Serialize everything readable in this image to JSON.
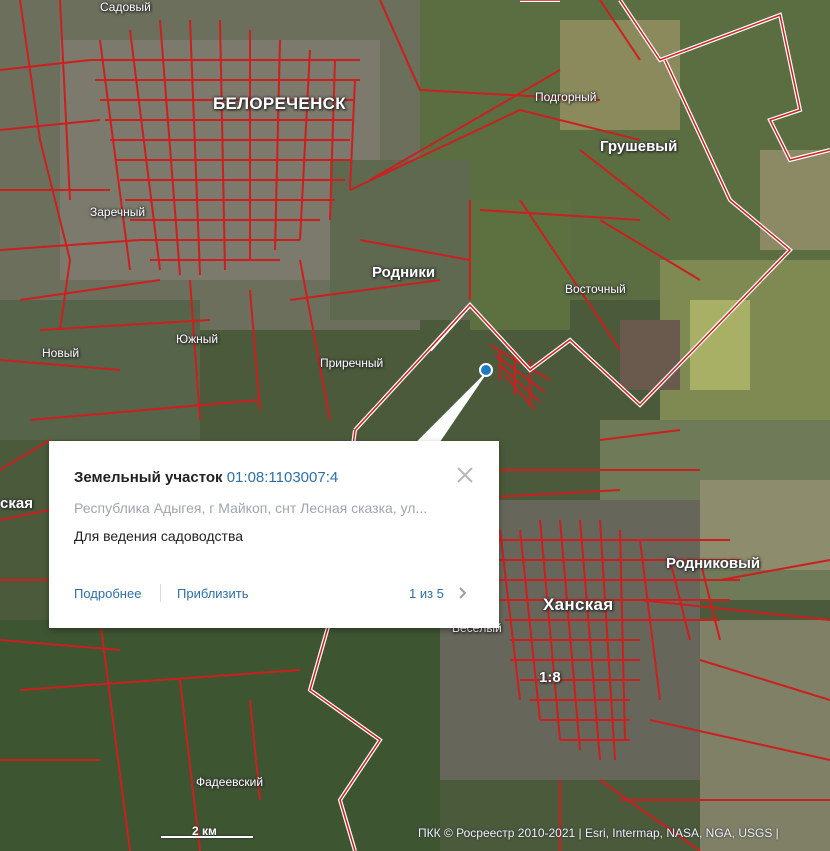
{
  "map": {
    "places": [
      {
        "id": "sadovyy",
        "name": "Садовый"
      },
      {
        "id": "belorechensk",
        "name": "БЕЛОРЕЧЕНСК"
      },
      {
        "id": "podgornyy",
        "name": "Подгорный"
      },
      {
        "id": "grushevyy",
        "name": "Грушевый"
      },
      {
        "id": "zarechnyy",
        "name": "Заречный"
      },
      {
        "id": "rodniki",
        "name": "Родники"
      },
      {
        "id": "vostochnyy",
        "name": "Восточный"
      },
      {
        "id": "yuzhnyy",
        "name": "Южный"
      },
      {
        "id": "novyy",
        "name": "Новый"
      },
      {
        "id": "prirechnyy",
        "name": "Приречный"
      },
      {
        "id": "skaya",
        "name": "ская"
      },
      {
        "id": "rodnikovyy",
        "name": "Родниковый"
      },
      {
        "id": "khanskaya",
        "name": "Ханская"
      },
      {
        "id": "veselyy",
        "name": "Весёлый"
      },
      {
        "id": "quarter",
        "name": "1:8"
      },
      {
        "id": "fadeevskiy",
        "name": "Фадеевский"
      }
    ],
    "border_color": "#ffffff",
    "parcel_color": "#cc1f1f",
    "scale_label": "2 км",
    "attribution": "ПКК © Росреестр 2010-2021 | Esri, Intermap, NASA, NGA, USGS | "
  },
  "popup": {
    "title_prefix": "Земельный участок",
    "cadastral_number": "01:08:1103007:4",
    "address": "Республика Адыгея, г Майкоп, снт Лесная сказка, ул...",
    "land_use": "Для ведения садоводства",
    "more_label": "Подробнее",
    "zoom_label": "Приблизить",
    "counter": "1 из 5",
    "close_icon": "close-icon",
    "next_icon": "chevron-right-icon"
  }
}
